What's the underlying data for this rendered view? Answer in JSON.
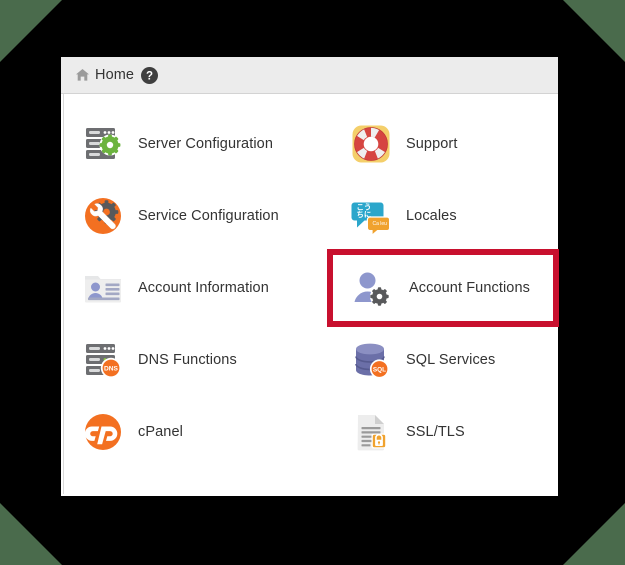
{
  "window": {
    "background_color": "#000000",
    "corner_color": "#4a6b4c",
    "panel_color": "#ffffff"
  },
  "breadcrumb": {
    "home_label": "Home",
    "home_icon": "home-icon",
    "help_icon": "help-circle-icon",
    "background_color": "#ececec"
  },
  "highlight": {
    "color": "#c8102e",
    "target": "Account Functions"
  },
  "home_grid": {
    "tiles": [
      {
        "label": "Server Configuration",
        "icon": "server-rack-gear-icon",
        "column": 1,
        "row": 1,
        "highlighted": false
      },
      {
        "label": "Support",
        "icon": "life-ring-icon",
        "column": 2,
        "row": 1,
        "highlighted": false
      },
      {
        "label": "Service Configuration",
        "icon": "wrench-gear-circle-icon",
        "column": 1,
        "row": 2,
        "highlighted": false
      },
      {
        "label": "Locales",
        "icon": "speech-bubbles-icon",
        "column": 2,
        "row": 2,
        "highlighted": false
      },
      {
        "label": "Account Information",
        "icon": "id-card-person-icon",
        "column": 1,
        "row": 3,
        "highlighted": false
      },
      {
        "label": "Account Functions",
        "icon": "person-gear-icon",
        "column": 2,
        "row": 3,
        "highlighted": true
      },
      {
        "label": "DNS Functions",
        "icon": "server-rack-dns-icon",
        "column": 1,
        "row": 4,
        "highlighted": false
      },
      {
        "label": "SQL Services",
        "icon": "database-sql-icon",
        "column": 2,
        "row": 4,
        "highlighted": false
      },
      {
        "label": "cPanel",
        "icon": "cpanel-logo-icon",
        "column": 1,
        "row": 5,
        "highlighted": false
      },
      {
        "label": "SSL/TLS",
        "icon": "document-lock-icon",
        "column": 2,
        "row": 5,
        "highlighted": false
      }
    ]
  },
  "colors": {
    "text": "#333333",
    "orange": "#f37021",
    "green_gear": "#6cb33f",
    "grey_icon": "#6d6e71",
    "blue_person": "#8e97cd",
    "sql_blue": "#6b6fa8",
    "locale_blue": "#2ba6cb",
    "support_red": "#d64541"
  }
}
